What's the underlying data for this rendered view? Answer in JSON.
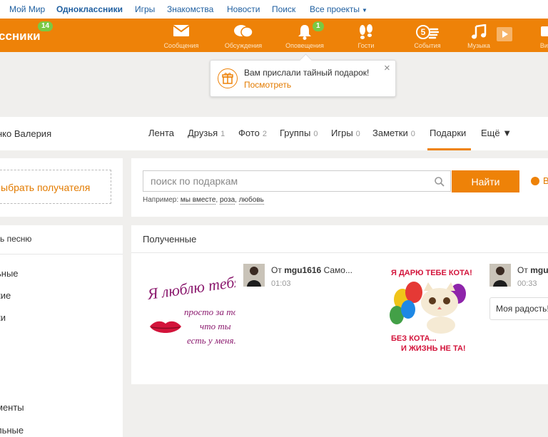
{
  "portal": {
    "links": [
      "Мой Мир",
      "Одноклассники",
      "Игры",
      "Знакомства",
      "Новости",
      "Поиск",
      "Все проекты"
    ]
  },
  "toolbar": {
    "logo": "ссники",
    "logo_badge": "14",
    "items": [
      {
        "label": "Сообщения",
        "icon": "envelope-icon"
      },
      {
        "label": "Обсуждения",
        "icon": "chat-bubbles-icon"
      },
      {
        "label": "Оповещения",
        "icon": "bell-icon",
        "badge": "1"
      },
      {
        "label": "Гости",
        "icon": "footprints-icon"
      },
      {
        "label": "События",
        "icon": "five-hand-icon"
      },
      {
        "label": "Музыка",
        "icon": "music-note-icon"
      },
      {
        "label": "Вид",
        "icon": "camera-icon"
      }
    ]
  },
  "notification": {
    "message": "Вам прислали тайный подарок!",
    "link": "Посмотреть",
    "close": "×"
  },
  "profile": {
    "name": "нко Валерия",
    "nav": [
      {
        "label": "Лента",
        "count": ""
      },
      {
        "label": "Друзья",
        "count": "1"
      },
      {
        "label": "Фото",
        "count": "2"
      },
      {
        "label": "Группы",
        "count": "0"
      },
      {
        "label": "Игры",
        "count": "0"
      },
      {
        "label": "Заметки",
        "count": "0"
      },
      {
        "label": "Подарки",
        "count": ""
      },
      {
        "label": "Ещё ▼",
        "count": ""
      }
    ]
  },
  "left": {
    "recipient": "ыбрать получателя",
    "song": "ь песню",
    "menu": [
      "ьные",
      "кие",
      "ки",
      "менты",
      "льные"
    ]
  },
  "search": {
    "placeholder": "поиск по подаркам",
    "button": "Найти",
    "example_prefix": "Например:",
    "examples": [
      "мы вместе",
      "роза",
      "любовь"
    ],
    "extra": "В"
  },
  "gifts": {
    "title": "Полученные",
    "items": [
      {
        "card_lines": [
          "Я люблю тебя",
          "просто за то,",
          "что ты",
          "есть у меня.."
        ],
        "sender_prefix": "От",
        "sender": "mgu1616",
        "sender_suffix": "Само...",
        "time": "01:03"
      },
      {
        "card_lines": [
          "Я ДАРЮ ТЕБЕ КОТА!",
          "БЕЗ КОТА...",
          "И ЖИЗНЬ НЕ ТА!"
        ],
        "sender_prefix": "От",
        "sender": "mgu",
        "time": "00:33",
        "comment": "Моя радость!"
      }
    ]
  },
  "colors": {
    "brand": "#ee8208",
    "link": "#1f5fa0",
    "badge": "#7ac943"
  }
}
